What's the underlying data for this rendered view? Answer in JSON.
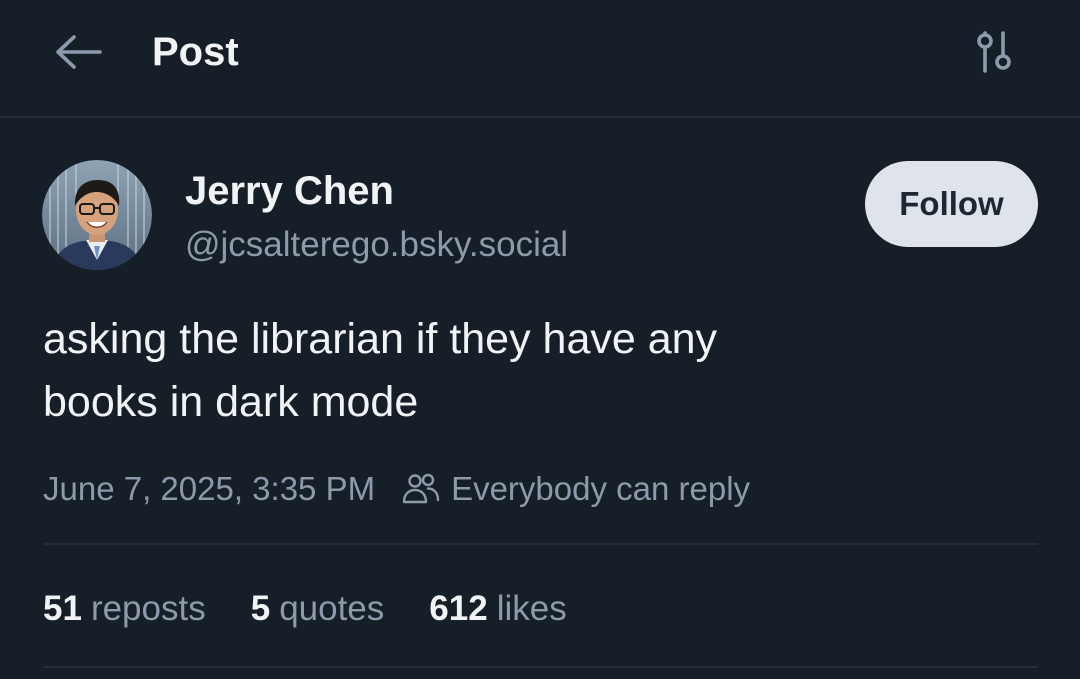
{
  "header": {
    "title": "Post",
    "back_icon": "arrow-left-icon",
    "settings_icon": "sliders-icon"
  },
  "author": {
    "name": "Jerry Chen",
    "handle": "@jcsalterego.bsky.social",
    "follow_label": "Follow"
  },
  "post": {
    "text_line1": "asking the librarian if they have any",
    "text_line2": "books in dark mode",
    "timestamp": "June 7, 2025, 3:35 PM",
    "reply_setting": "Everybody can reply",
    "reply_icon": "people-icon"
  },
  "stats": {
    "reposts_count": "51",
    "reposts_label": "reposts",
    "quotes_count": "5",
    "quotes_label": "quotes",
    "likes_count": "612",
    "likes_label": "likes"
  },
  "colors": {
    "background": "#161e27",
    "text_primary": "#f1f3f5",
    "text_secondary": "#8d9aab",
    "divider": "#232e3b",
    "follow_button_bg": "#dfe4ea",
    "follow_button_text": "#1d2834"
  }
}
